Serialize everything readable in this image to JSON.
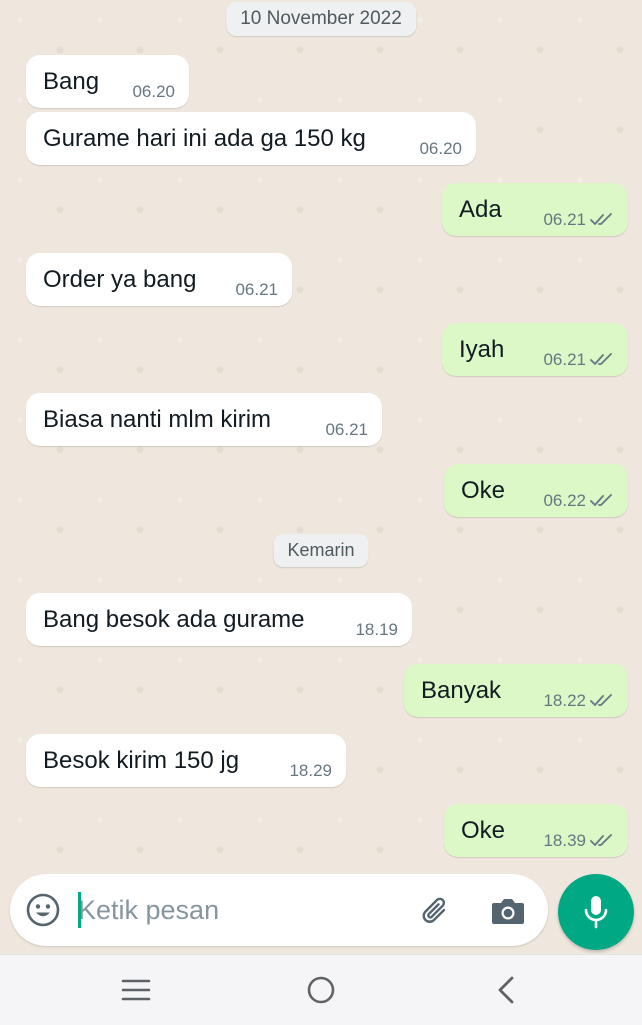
{
  "conversation": {
    "date_separators": {
      "first": "10 November 2022",
      "second": "Kemarin"
    },
    "messages": [
      {
        "direction": "incoming",
        "text": "Bang",
        "time": "06.20"
      },
      {
        "direction": "incoming",
        "text": "Gurame hari ini ada ga 150 kg",
        "time": "06.20"
      },
      {
        "direction": "outgoing",
        "text": "Ada",
        "time": "06.21",
        "status": "double-check-icon"
      },
      {
        "direction": "incoming",
        "text": "Order ya bang",
        "time": "06.21"
      },
      {
        "direction": "outgoing",
        "text": "Iyah",
        "time": "06.21",
        "status": "double-check-icon"
      },
      {
        "direction": "incoming",
        "text": "Biasa nanti mlm kirim",
        "time": "06.21"
      },
      {
        "direction": "outgoing",
        "text": "Oke",
        "time": "06.22",
        "status": "double-check-icon"
      },
      {
        "direction": "incoming",
        "text": "Bang besok ada gurame",
        "time": "18.19"
      },
      {
        "direction": "outgoing",
        "text": "Banyak",
        "time": "18.22",
        "status": "double-check-icon"
      },
      {
        "direction": "incoming",
        "text": "Besok kirim 150 jg",
        "time": "18.29"
      },
      {
        "direction": "outgoing",
        "text": "Oke",
        "time": "18.39",
        "status": "double-check-icon"
      }
    ]
  },
  "composer": {
    "placeholder": "Ketik pesan",
    "emoji_icon": "emoji-icon",
    "attach_icon": "paperclip-icon",
    "camera_icon": "camera-icon",
    "mic_icon": "microphone-icon"
  },
  "navigation": {
    "menu_icon": "recent-apps-icon",
    "home_icon": "home-icon",
    "back_icon": "back-icon"
  },
  "colors": {
    "accent": "#00a884",
    "outgoing_bubble": "#dbf8c6",
    "incoming_bubble": "#ffffff",
    "chat_background": "#efe7dd",
    "read_ticks": "#667781"
  }
}
